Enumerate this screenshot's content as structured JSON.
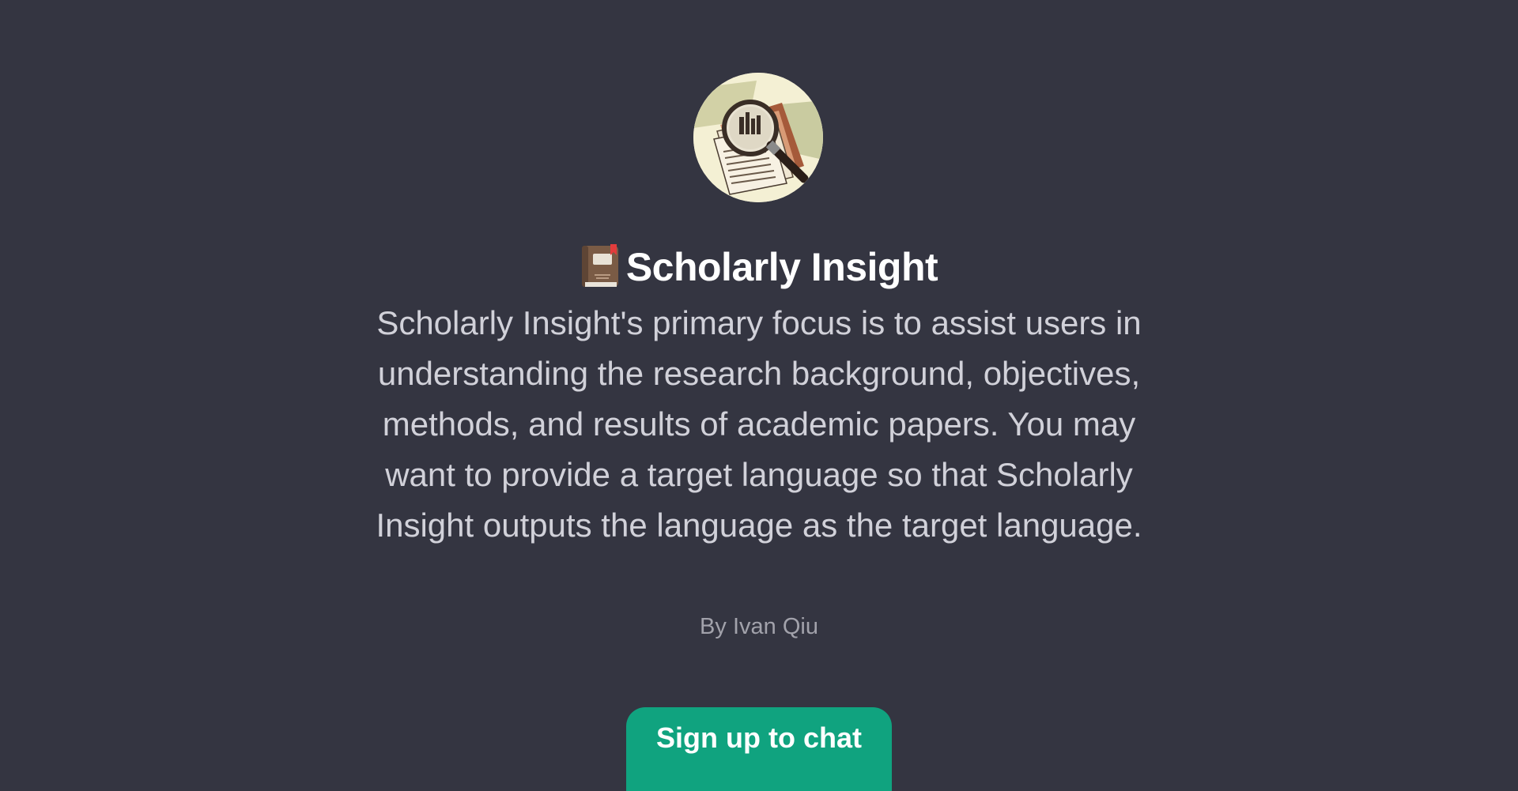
{
  "gpt": {
    "title_icon": "closed-book-with-bookmark-icon",
    "name": "Scholarly Insight",
    "description": "Scholarly Insight's primary focus is to assist users in understanding the research background, objectives, methods, and results of academic papers. You may want to provide a target language so that Scholarly Insight outputs the language as the target language.",
    "author": "By Ivan Qiu",
    "avatar_icon": "magnifying-glass-over-papers-icon"
  },
  "actions": {
    "signup_label": "Sign up to chat"
  },
  "colors": {
    "background": "#343541",
    "title": "#ffffff",
    "description": "#d1d1d9",
    "author": "#a2a2ab",
    "button": "#10a37f"
  }
}
